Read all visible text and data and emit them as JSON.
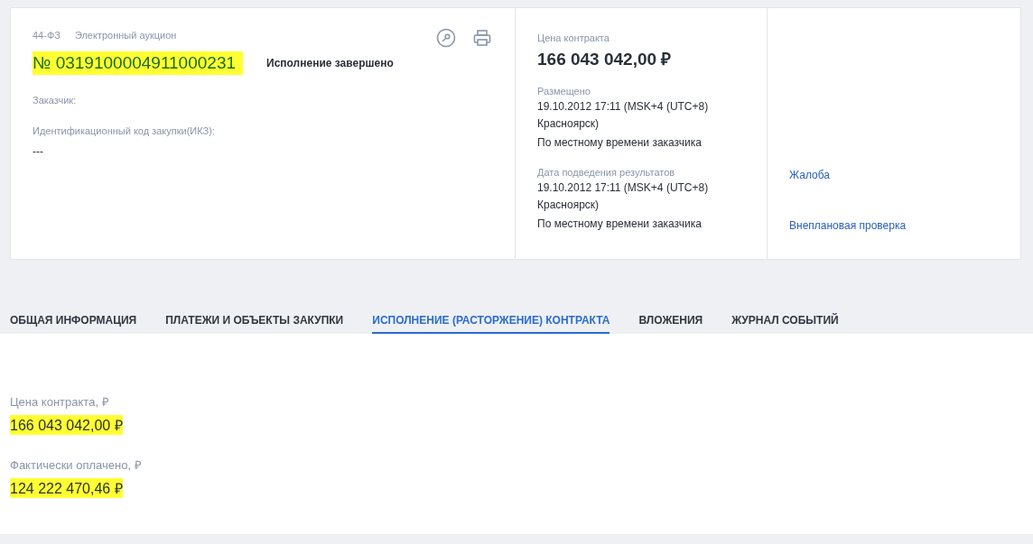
{
  "header": {
    "law": "44-ФЗ",
    "procedure": "Электронный аукцион",
    "number": {
      "text": "№ 0319100004911000231",
      "highlighted": true
    },
    "status": "Исполнение завершено",
    "fields": [
      {
        "label": "Заказчик:"
      },
      {
        "label": "Идентификационный код закупки(ИКЗ):",
        "value": "---"
      }
    ]
  },
  "price": {
    "label": "Цена контракта",
    "value": "166 043 042,00 ₽"
  },
  "dates": [
    {
      "label": "Размещено",
      "value": "19.10.2012 17:11 (MSK+4 (UTC+8) Красноярск)",
      "note": "По местному времени заказчика"
    },
    {
      "label": "Дата подведения результатов",
      "value": "19.10.2012 17:11 (MSK+4 (UTC+8) Красноярск)",
      "note": "По местному времени заказчика"
    }
  ],
  "links": [
    "Жалоба",
    "Внеплановая проверка"
  ],
  "tabs": [
    {
      "label": "ОБЩАЯ ИНФОРМАЦИЯ",
      "selected": false
    },
    {
      "label": "ПЛАТЕЖИ И ОБЪЕКТЫ ЗАКУПКИ",
      "selected": false
    },
    {
      "label": "ИСПОЛНЕНИЕ (РАСТОРЖЕНИЕ) КОНТРАКТА",
      "selected": true
    },
    {
      "label": "ВЛОЖЕНИЯ",
      "selected": false
    },
    {
      "label": "ЖУРНАЛ СОБЫТИЙ",
      "selected": false
    }
  ],
  "details": [
    {
      "label": "Цена контракта, ₽",
      "value": "166 043 042,00 ₽",
      "highlighted": true
    },
    {
      "label": "Фактически оплачено, ₽",
      "value": "124 222 470,46 ₽",
      "highlighted": true
    }
  ]
}
